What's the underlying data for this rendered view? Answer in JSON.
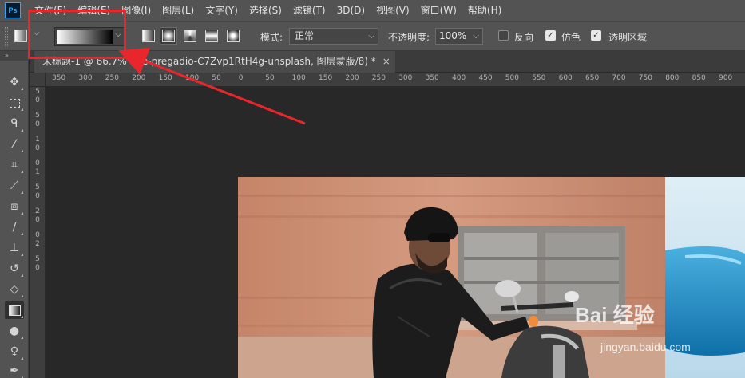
{
  "app": {
    "logo": "Ps"
  },
  "menu": [
    "文件(F)",
    "编辑(E)",
    "图像(I)",
    "图层(L)",
    "文字(Y)",
    "选择(S)",
    "滤镜(T)",
    "3D(D)",
    "视图(V)",
    "窗口(W)",
    "帮助(H)"
  ],
  "options": {
    "mode_label": "模式:",
    "mode_value": "正常",
    "opacity_label": "不透明度:",
    "opacity_value": "100%",
    "reverse_label": "反向",
    "reverse_checked": false,
    "dither_label": "仿色",
    "dither_checked": true,
    "transparency_label": "透明区域",
    "transparency_checked": true,
    "gradient_types": [
      "linear-gradient-icon",
      "radial-gradient-icon",
      "angle-gradient-icon",
      "reflected-gradient-icon",
      "diamond-gradient-icon"
    ],
    "selected_gradient_type": "radial-gradient-icon"
  },
  "document_tab": {
    "title": "未标题-1 @ 66.7% (joe-pregadio-C7Zvp1RtH4g-unsplash, 图层蒙版/8) *",
    "close": "×"
  },
  "ruler_h": [
    "350",
    "300",
    "250",
    "200",
    "150",
    "100",
    "50",
    "0",
    "50",
    "100",
    "150",
    "200",
    "250",
    "300",
    "350",
    "400",
    "450",
    "500",
    "550",
    "600",
    "650",
    "700",
    "750",
    "800",
    "850",
    "900"
  ],
  "ruler_v": [
    "5",
    "0",
    "5",
    "0",
    "1",
    "0",
    "0",
    "1",
    "5",
    "0",
    "2",
    "0",
    "0",
    "2",
    "5",
    "0"
  ],
  "tools": [
    "move-tool-icon",
    "marquee-tool-icon",
    "lasso-tool-icon",
    "magic-wand-icon",
    "crop-tool-icon",
    "eyedropper-icon",
    "healing-brush-icon",
    "brush-tool-icon",
    "clone-stamp-icon",
    "history-brush-icon",
    "eraser-icon",
    "gradient-tool-icon",
    "blur-tool-icon",
    "dodge-tool-icon",
    "pen-tool-icon"
  ],
  "active_tool": "gradient-tool-icon",
  "annotation": {
    "highlight_color": "#e8262c"
  },
  "watermark": {
    "brand": "Bai 经验",
    "url": "jingyan.baidu.com"
  }
}
